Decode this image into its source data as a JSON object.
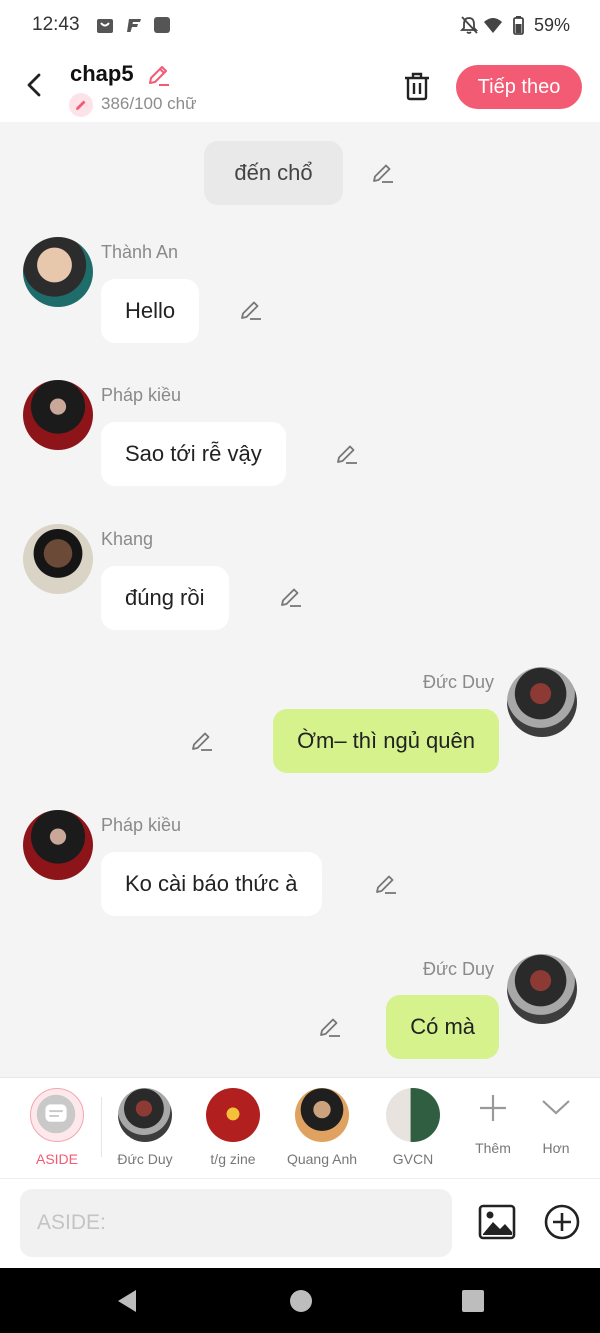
{
  "status_bar": {
    "time": "12:43",
    "battery": "59%"
  },
  "header": {
    "title": "chap5",
    "word_count": "386/100 chữ",
    "next_label": "Tiếp theo"
  },
  "messages": [
    {
      "type": "narration",
      "text": "đến chổ"
    },
    {
      "side": "left",
      "name": "Thành An",
      "text": "Hello"
    },
    {
      "side": "left",
      "name": "Pháp kiều",
      "text": "Sao tới rễ vậy"
    },
    {
      "side": "left",
      "name": "Khang",
      "text": "đúng rồi"
    },
    {
      "side": "right",
      "name": "Đức Duy",
      "text": "Ờm– thì ngủ quên"
    },
    {
      "side": "left",
      "name": "Pháp kiều",
      "text": "Ko cài báo thức à"
    },
    {
      "side": "right",
      "name": "Đức Duy",
      "text": "Có mà"
    }
  ],
  "characters": [
    {
      "label": "ASIDE",
      "selected": true
    },
    {
      "label": "Đức Duy"
    },
    {
      "label": "t/g zine"
    },
    {
      "label": "Quang Anh"
    },
    {
      "label": "GVCN"
    },
    {
      "label": "Thêm"
    },
    {
      "label": "Hơn"
    }
  ],
  "input": {
    "placeholder": "ASIDE:"
  },
  "colors": {
    "accent": "#f35a73",
    "bubble_right": "#d6f28c",
    "bubble_left": "#ffffff",
    "background": "#f4f4f4"
  }
}
